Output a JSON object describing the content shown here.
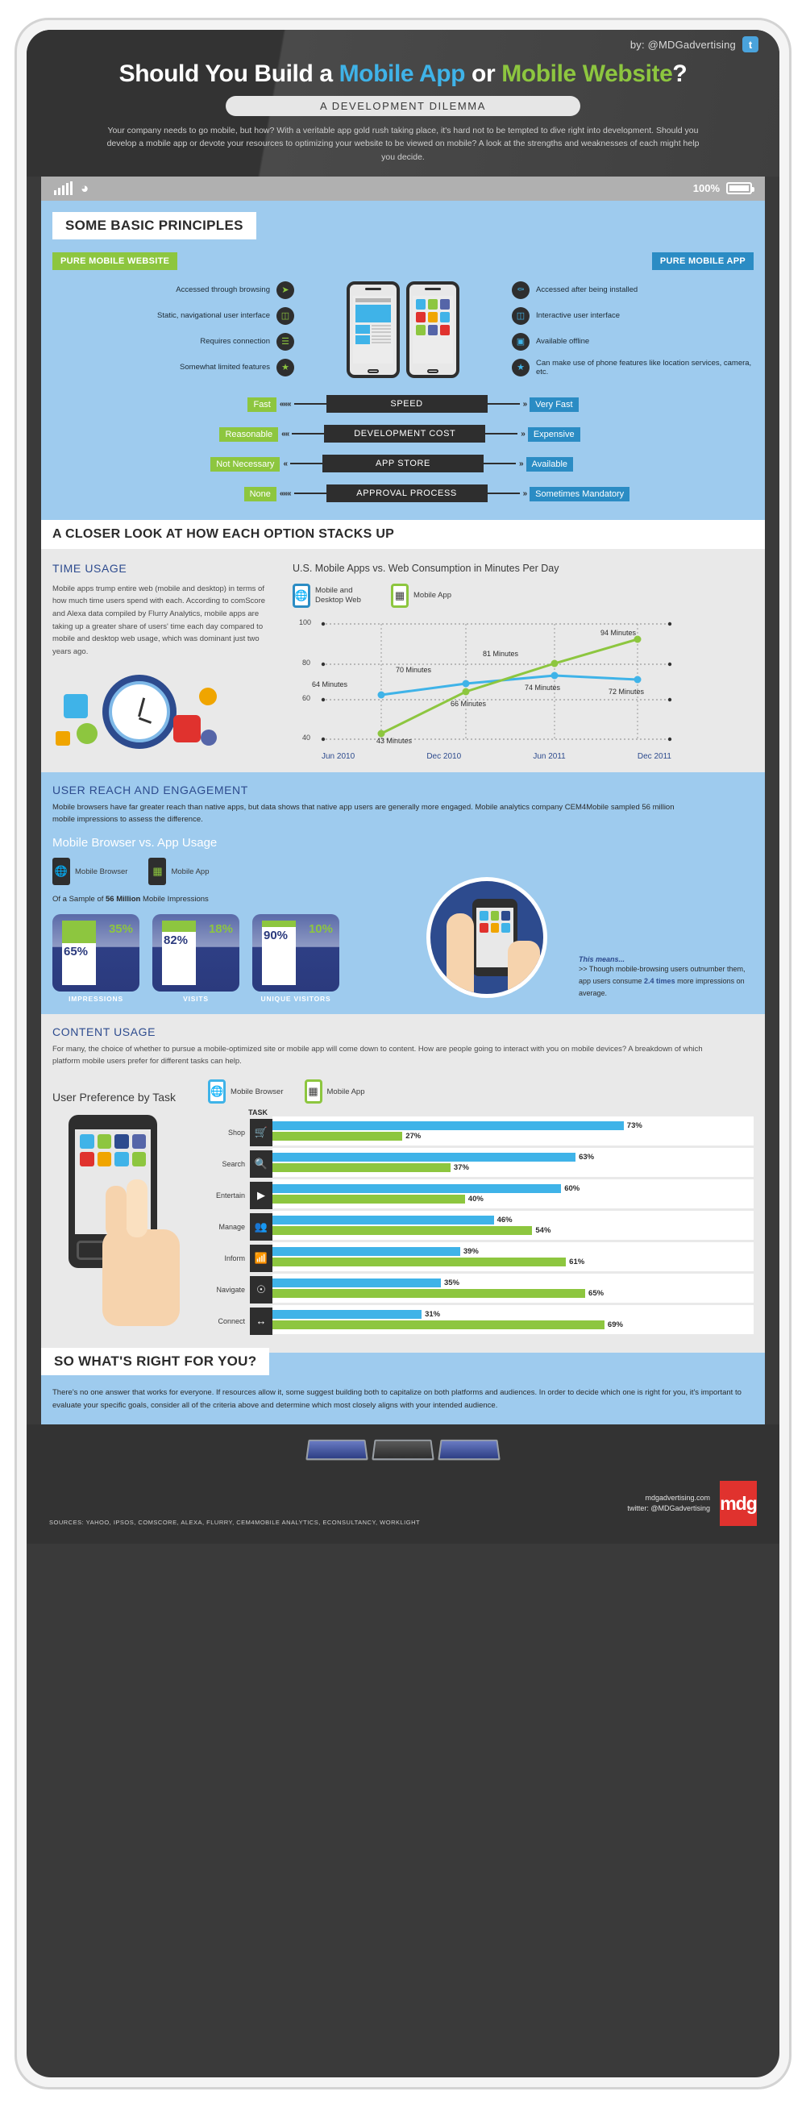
{
  "header": {
    "byline": "by: @MDGadvertising",
    "twitter_icon": "twitter-bird-icon",
    "title_part1": "Should You Build a ",
    "title_app": "Mobile App",
    "title_mid": " or ",
    "title_web": "Mobile Website",
    "title_end": "?",
    "subtitle": "A DEVELOPMENT DILEMMA",
    "intro": "Your company needs to go mobile, but how? With a veritable app gold rush taking place, it's hard not to be tempted to dive right into development. Should you develop a mobile app or devote your resources to optimizing your website to be viewed on mobile? A look at the strengths and weaknesses of each might help you decide."
  },
  "statusbar": {
    "battery_pct": "100%",
    "signal_icon": "signal-bars-icon",
    "wifi_icon": "wifi-icon",
    "battery_icon": "battery-icon"
  },
  "principles": {
    "heading": "SOME BASIC PRINCIPLES",
    "left_pill": "PURE MOBILE WEBSITE",
    "right_pill": "PURE MOBILE APP",
    "left_features": [
      {
        "label": "Accessed through browsing",
        "icon": "cursor-arrow-icon"
      },
      {
        "label": "Static, navigational user interface",
        "icon": "window-ui-icon"
      },
      {
        "label": "Requires connection",
        "icon": "signal-bars-icon"
      },
      {
        "label": "Somewhat limited features",
        "icon": "star-icon"
      }
    ],
    "right_features": [
      {
        "label": "Accessed after being installed",
        "icon": "key-icon"
      },
      {
        "label": "Interactive user interface",
        "icon": "window-ui-icon"
      },
      {
        "label": "Available offline",
        "icon": "offline-device-icon"
      },
      {
        "label": "Can make use of phone features like location services, camera, etc.",
        "icon": "star-icon"
      }
    ],
    "comparisons": [
      {
        "criterion": "SPEED",
        "web": "Fast",
        "app": "Very Fast",
        "icon": "speedometer-icon",
        "left_chevrons": "«««",
        "right_chevrons": "»"
      },
      {
        "criterion": "DEVELOPMENT COST",
        "web": "Reasonable",
        "app": "Expensive",
        "icon": "cost-dial-icon",
        "left_chevrons": "««",
        "right_chevrons": "»"
      },
      {
        "criterion": "APP STORE",
        "web": "Not Necessary",
        "app": "Available",
        "icon": "shopping-cart-icon",
        "left_chevrons": "«",
        "right_chevrons": "»"
      },
      {
        "criterion": "APPROVAL PROCESS",
        "web": "None",
        "app": "Sometimes Mandatory",
        "icon": "approval-node-icon",
        "left_chevrons": "«««",
        "right_chevrons": "»"
      }
    ]
  },
  "closer_look": {
    "heading": "A CLOSER LOOK AT HOW EACH OPTION STACKS UP"
  },
  "time_usage": {
    "heading": "TIME USAGE",
    "body": "Mobile apps trump entire web (mobile and desktop) in terms of how much time users spend with each. According to comScore and Alexa data compiled by Flurry Analytics, mobile apps are taking up a greater share of users' time each day compared to mobile and desktop web usage, which was dominant just two years ago.",
    "clock_icon": "clock-illustration-icon"
  },
  "user_reach": {
    "heading": "USER REACH AND ENGAGEMENT",
    "body": "Mobile browsers have far greater reach than native apps, but data shows that native app users are generally more engaged. Mobile analytics company CEM4Mobile sampled 56 million mobile impressions to assess the difference.",
    "chart_heading": "Mobile Browser vs. App Usage",
    "legend": [
      {
        "label": "Mobile Browser",
        "icon": "globe-phone-icon",
        "color": "#2e2e2e"
      },
      {
        "label": "Mobile App",
        "icon": "app-grid-phone-icon",
        "color": "#8dc63f"
      }
    ],
    "sample_prefix": "Of a Sample of ",
    "sample_bold": "56 Million",
    "sample_suffix": " Mobile Impressions",
    "this_means_label": "This means...",
    "this_means_prefix": ">> Though mobile-browsing users outnumber them, app users consume ",
    "this_means_bold": "2.4 times",
    "this_means_suffix": " more impressions on average.",
    "hand_icon": "hand-holding-phone-illustration"
  },
  "content_usage": {
    "heading": "CONTENT USAGE",
    "body": "For many, the choice of whether to pursue a mobile-optimized site or mobile app will come down to content. How are people going to interact with you on mobile devices? A breakdown of which platform mobile users prefer for different tasks can help.",
    "chart_heading": "User Preference by Task",
    "task_col_label": "TASK",
    "legend": [
      {
        "label": "Mobile Browser",
        "icon": "globe-phone-icon",
        "color": "#3fb3e8"
      },
      {
        "label": "Mobile App",
        "icon": "app-grid-phone-icon",
        "color": "#8dc63f"
      }
    ],
    "phone_hand_icon": "hand-holding-phone-illustration"
  },
  "conclusion": {
    "heading": "SO WHAT'S RIGHT FOR YOU?",
    "body": "There's no one answer that works for everyone. If resources allow it, some suggest building both to capitalize on both platforms and audiences. In order to decide which one is right for you, it's important to evaluate your specific goals, consider all of the criteria above and determine which most closely aligns with your intended audience."
  },
  "footer": {
    "sources": "SOURCES: YAHOO, IPSOS, COMSCORE, ALEXA, FLURRY, CEM4MOBILE ANALYTICS, ECONSULTANCY, WORKLIGHT",
    "website": "mdgadvertising.com",
    "twitter": "twitter: @MDGadvertising",
    "logo_text": "mdg"
  },
  "chart_data": [
    {
      "type": "line",
      "title": "U.S. Mobile Apps vs. Web Consumption in Minutes Per Day",
      "xlabel": "",
      "ylabel": "",
      "categories": [
        "Jun 2010",
        "Dec 2010",
        "Jun 2011",
        "Dec 2011"
      ],
      "ylim": [
        40,
        100
      ],
      "yticks": [
        40,
        60,
        80,
        100
      ],
      "grid": true,
      "legend_position": "top",
      "series": [
        {
          "name": "Mobile and Desktop Web",
          "color": "#3fb3e8",
          "values": [
            64,
            70,
            74,
            72
          ],
          "labels": [
            "64 Minutes",
            "70 Minutes",
            "74 Minutes",
            "72 Minutes"
          ]
        },
        {
          "name": "Mobile App",
          "color": "#8dc63f",
          "values": [
            43,
            66,
            81,
            94
          ],
          "labels": [
            "43 Minutes",
            "66 Minutes",
            "81 Minutes",
            "94 Minutes"
          ]
        }
      ]
    },
    {
      "type": "bar",
      "title": "Mobile Browser vs. App Usage",
      "categories": [
        "IMPRESSIONS",
        "VISITS",
        "UNIQUE VISITORS"
      ],
      "unit": "%",
      "series": [
        {
          "name": "Mobile Browser",
          "color": "#ffffff",
          "values": [
            65,
            82,
            90
          ],
          "labels": [
            "65%",
            "82%",
            "90%"
          ]
        },
        {
          "name": "Mobile App",
          "color": "#8dc63f",
          "values": [
            35,
            18,
            10
          ],
          "labels": [
            "35%",
            "18%",
            "10%"
          ]
        }
      ]
    },
    {
      "type": "bar",
      "title": "User Preference by Task",
      "orientation": "horizontal",
      "categories": [
        "Shop",
        "Search",
        "Entertain",
        "Manage",
        "Inform",
        "Navigate",
        "Connect"
      ],
      "category_icons": [
        "shopping-cart-icon",
        "magnifier-icon",
        "play-button-icon",
        "people-group-icon",
        "rss-feed-icon",
        "compass-icon",
        "connect-arrows-icon"
      ],
      "unit": "%",
      "xlim": [
        0,
        100
      ],
      "series": [
        {
          "name": "Mobile Browser",
          "color": "#3fb3e8",
          "values": [
            73,
            63,
            60,
            46,
            39,
            35,
            31
          ],
          "labels": [
            "73%",
            "63%",
            "60%",
            "46%",
            "39%",
            "35%",
            "31%"
          ]
        },
        {
          "name": "Mobile App",
          "color": "#8dc63f",
          "values": [
            27,
            37,
            40,
            54,
            61,
            65,
            69
          ],
          "labels": [
            "27%",
            "37%",
            "40%",
            "54%",
            "61%",
            "65%",
            "69%"
          ]
        }
      ]
    }
  ]
}
